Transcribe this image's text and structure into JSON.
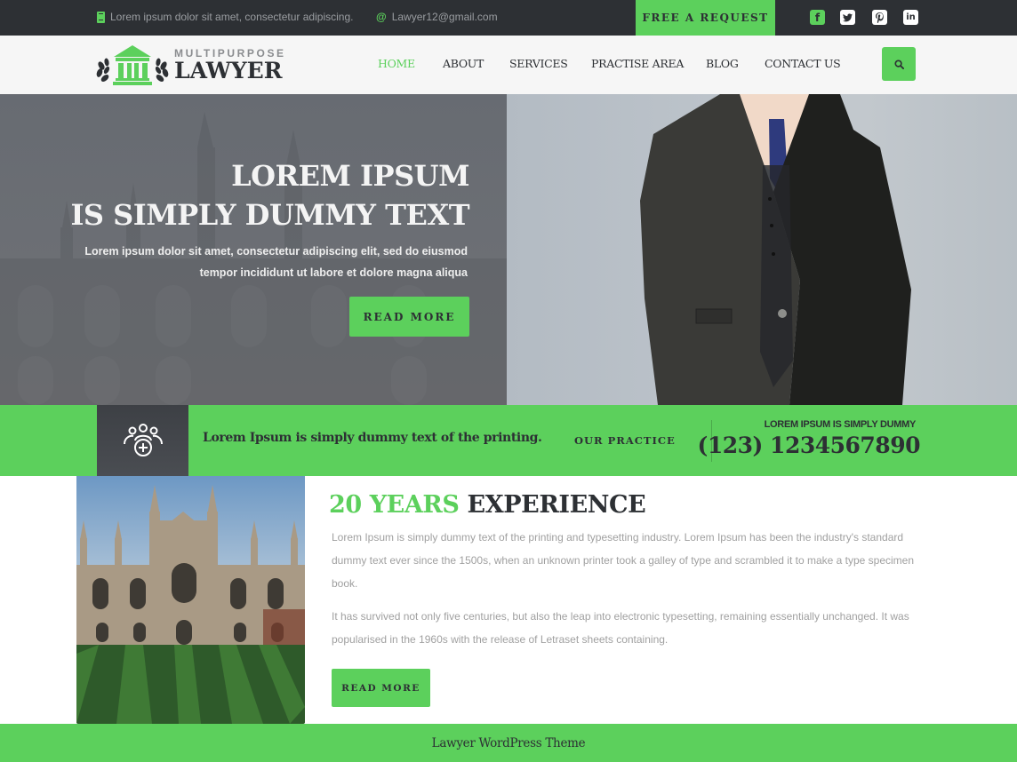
{
  "colors": {
    "accent": "#5cd05c",
    "dark": "#2d3034",
    "header_bg": "#f6f6f6",
    "body_text": "#a0a0a0"
  },
  "topbar": {
    "address_icon": "phone-icon",
    "address": "Lorem ipsum dolor sit amet, consectetur adipiscing.",
    "email_icon": "at-icon",
    "email": "Lawyer12@gmail.com",
    "request_button": "FREE A REQUEST",
    "social": [
      {
        "name": "facebook-icon",
        "glyph": "f"
      },
      {
        "name": "twitter-icon",
        "glyph": "t"
      },
      {
        "name": "pinterest-icon",
        "glyph": "p"
      },
      {
        "name": "linkedin-icon",
        "glyph": "in"
      }
    ]
  },
  "header": {
    "logo_small": "MULTIPURPOSE",
    "logo_big": "LAWYER",
    "nav": [
      {
        "label": "HOME",
        "active": true
      },
      {
        "label": "ABOUT",
        "active": false
      },
      {
        "label": "SERVICES",
        "active": false
      },
      {
        "label": "PRACTISE AREA",
        "active": false
      },
      {
        "label": "BLOG",
        "active": false
      },
      {
        "label": "CONTACT US",
        "active": false
      }
    ],
    "search_icon": "search-icon"
  },
  "hero": {
    "title_line1": "LOREM IPSUM",
    "title_line2": "IS SIMPLY DUMMY TEXT",
    "text_line1": "Lorem ipsum dolor sit amet, consectetur adipiscing elit, sed do eiusmod",
    "text_line2": "tempor incididunt ut labore et dolore magna aliqua",
    "button": "READ MORE"
  },
  "strip": {
    "icon": "group-add-icon",
    "text": "Lorem Ipsum is simply dummy text of the printing.",
    "practice_link": "OUR PRACTICE",
    "caption": "LOREM IPSUM IS SIMPLY DUMMY",
    "phone": "(123) 1234567890"
  },
  "about": {
    "title_accent": "20 YEARS",
    "title_rest": "EXPERIENCE",
    "paragraph1": "Lorem Ipsum is simply dummy text of the printing and typesetting industry. Lorem Ipsum has been the industry's standard dummy text ever since the 1500s, when an unknown printer took a galley of type and scrambled it to make a type specimen book.",
    "paragraph2": "It has survived not only five centuries, but also the leap into electronic typesetting, remaining essentially unchanged. It was popularised in the 1960s with the release of Letraset sheets containing.",
    "button": "READ MORE"
  },
  "footer": {
    "text": "Lawyer WordPress Theme"
  }
}
